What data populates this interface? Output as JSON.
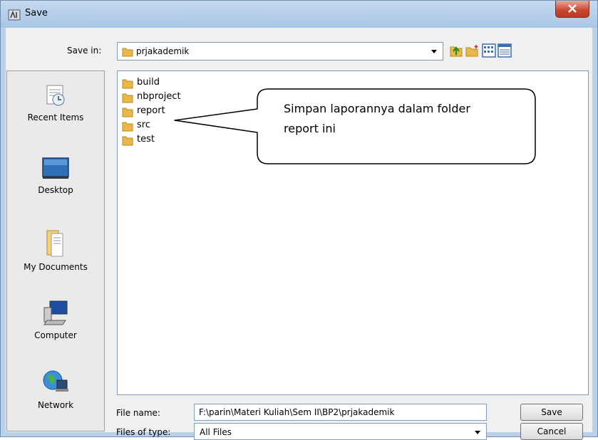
{
  "window": {
    "title": "Save"
  },
  "toolbar": {
    "save_in_label": "Save in:",
    "save_in_value": "prjakademik"
  },
  "places": [
    {
      "label": "Recent Items",
      "icon": "recent-items-icon"
    },
    {
      "label": "Desktop",
      "icon": "desktop-icon"
    },
    {
      "label": "My Documents",
      "icon": "my-documents-icon"
    },
    {
      "label": "Computer",
      "icon": "computer-icon"
    },
    {
      "label": "Network",
      "icon": "network-icon"
    }
  ],
  "files": [
    "build",
    "nbproject",
    "report",
    "src",
    "test"
  ],
  "form": {
    "file_name_label": "File name:",
    "file_name_value": "F:\\parin\\Materi Kuliah\\Sem II\\BP2\\prjakademik",
    "files_of_type_label": "Files of type:",
    "files_of_type_value": "All Files",
    "save_label": "Save",
    "cancel_label": "Cancel"
  },
  "callout": {
    "line1": "Simpan laporannya dalam folder",
    "line2": "report ini"
  },
  "colors": {
    "titlebar": "#b9d1ea",
    "close": "#c7442e",
    "folder": "#e8b84a",
    "dialog": "#f0f0f0"
  }
}
